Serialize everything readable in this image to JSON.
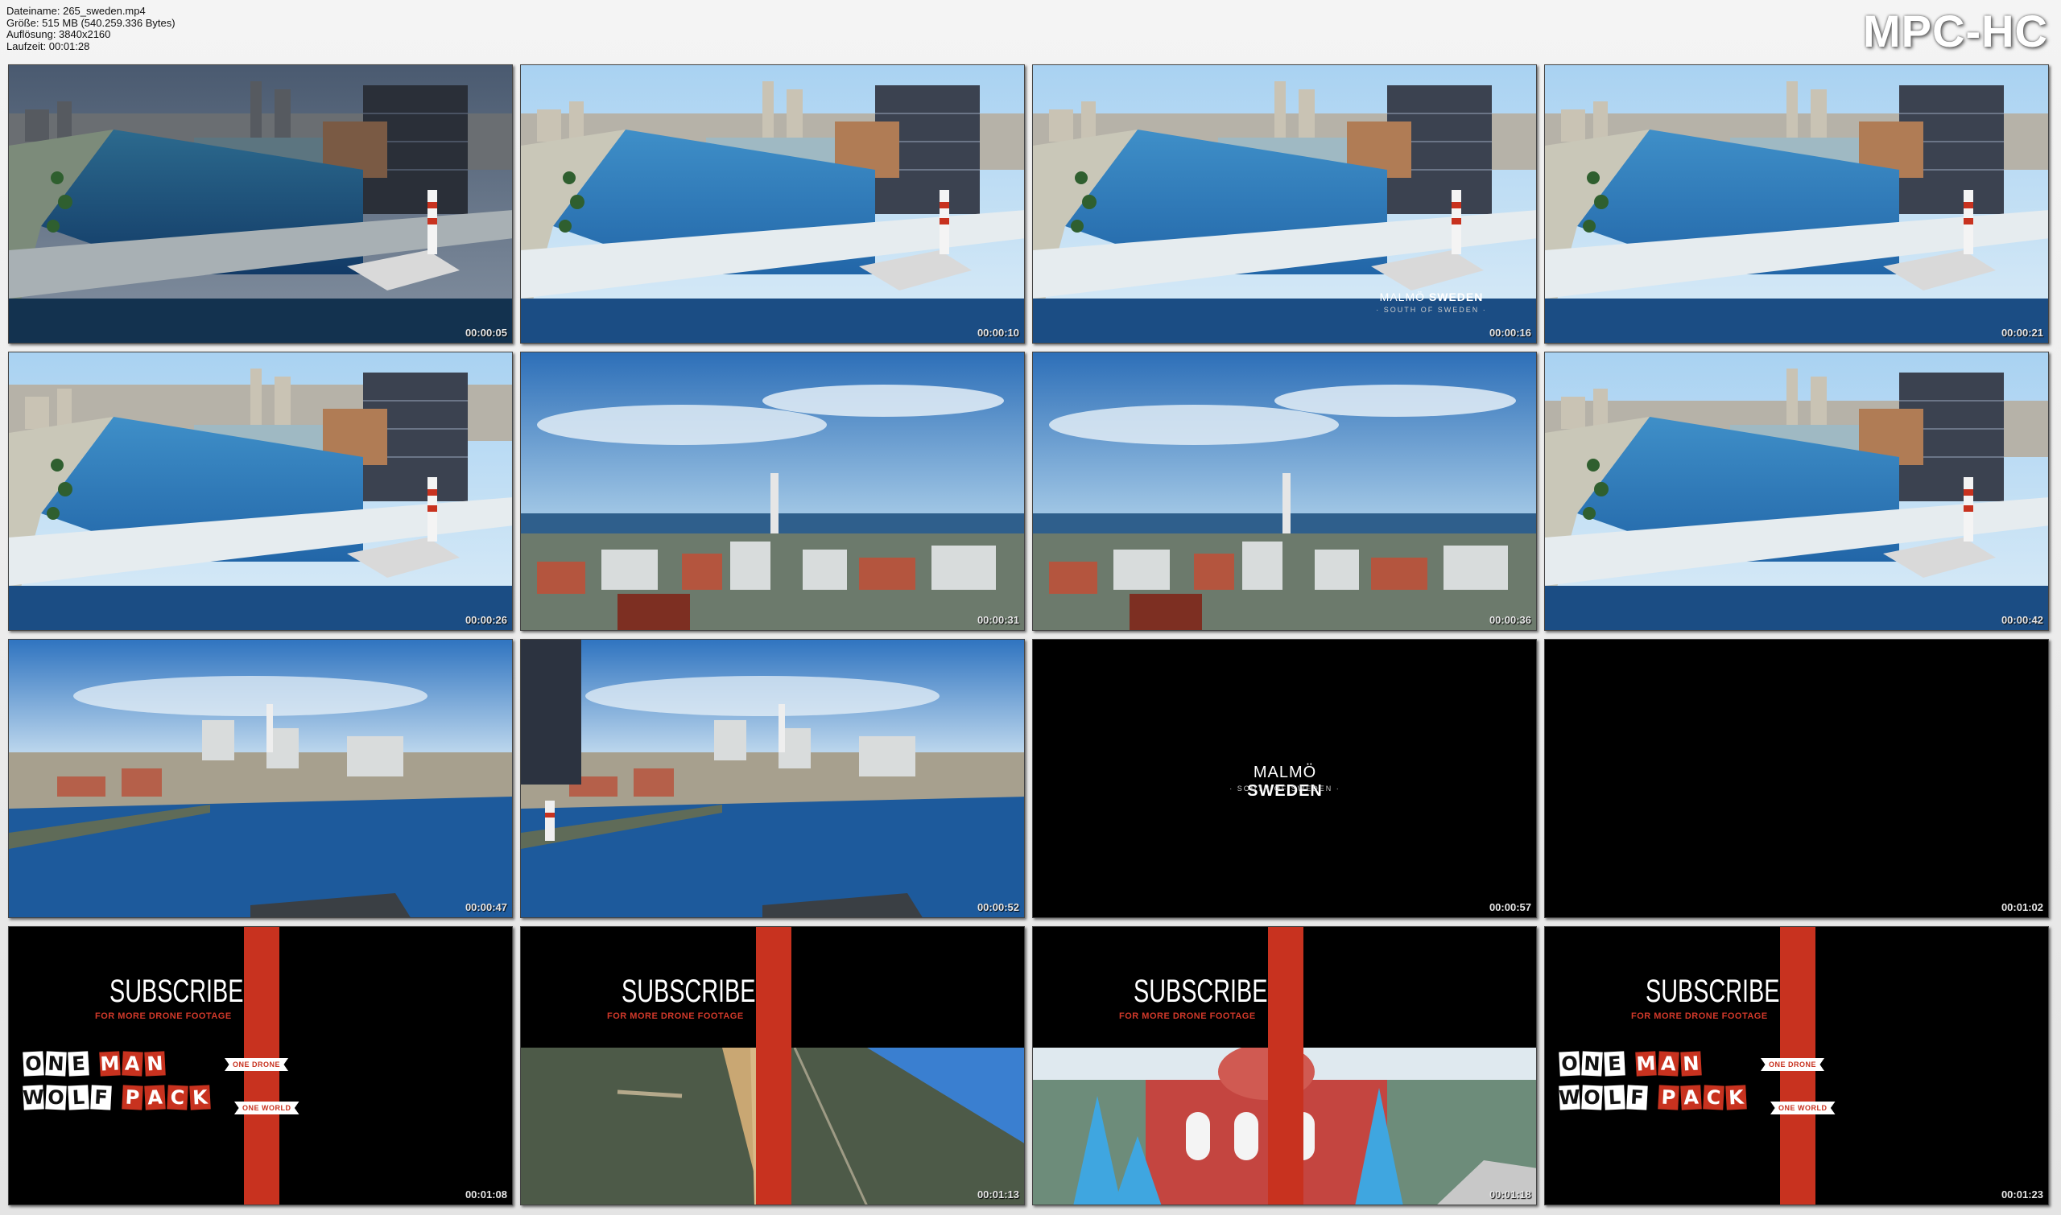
{
  "file_info": {
    "filename": "Dateiname: 265_sweden.mp4",
    "size": "Größe: 515 MB (540.259.336 Bytes)",
    "resolution": "Auflösung: 3840x2160",
    "duration": "Laufzeit: 00:01:28"
  },
  "brand": "MPC-HC",
  "thumbnails": [
    {
      "scene": "harbor-dark",
      "time": "00:00:05"
    },
    {
      "scene": "harbor",
      "time": "00:00:10"
    },
    {
      "scene": "harbor-title",
      "time": "00:00:16"
    },
    {
      "scene": "harbor-wide",
      "time": "00:00:21"
    },
    {
      "scene": "harbor-close",
      "time": "00:00:26"
    },
    {
      "scene": "city-sky",
      "time": "00:00:31"
    },
    {
      "scene": "city-sky",
      "time": "00:00:36"
    },
    {
      "scene": "harbor-wide",
      "time": "00:00:42"
    },
    {
      "scene": "water-city",
      "time": "00:00:47"
    },
    {
      "scene": "water-city-tower",
      "time": "00:00:52"
    },
    {
      "scene": "black-title",
      "time": "00:00:57"
    },
    {
      "scene": "black",
      "time": "00:01:02"
    },
    {
      "scene": "subscribe-wolf",
      "time": "00:01:08"
    },
    {
      "scene": "subscribe-road",
      "time": "00:01:13"
    },
    {
      "scene": "subscribe-church",
      "time": "00:01:18"
    },
    {
      "scene": "subscribe-wolf",
      "time": "00:01:23"
    }
  ],
  "overlays": {
    "malmo_light": "MALMÖ",
    "malmo_bold": "SWEDEN",
    "malmo_sub": "· SOUTH OF SWEDEN ·",
    "subscribe": "SUBSCRIBE",
    "subscribe_sub": "FOR MORE DRONE FOOTAGE",
    "wolf_line1": [
      "O",
      "N",
      "E",
      "",
      "M",
      "A",
      "N"
    ],
    "wolf_line2": [
      "W",
      "O",
      "L",
      "F",
      "",
      "P",
      "A",
      "C",
      "K"
    ],
    "ribbon_top": "ONE DRONE",
    "ribbon_bottom": "ONE WORLD"
  },
  "colors": {
    "brand_red": "#c8321f",
    "sky": "#9fc8ea",
    "water": "#1f5d9c"
  }
}
